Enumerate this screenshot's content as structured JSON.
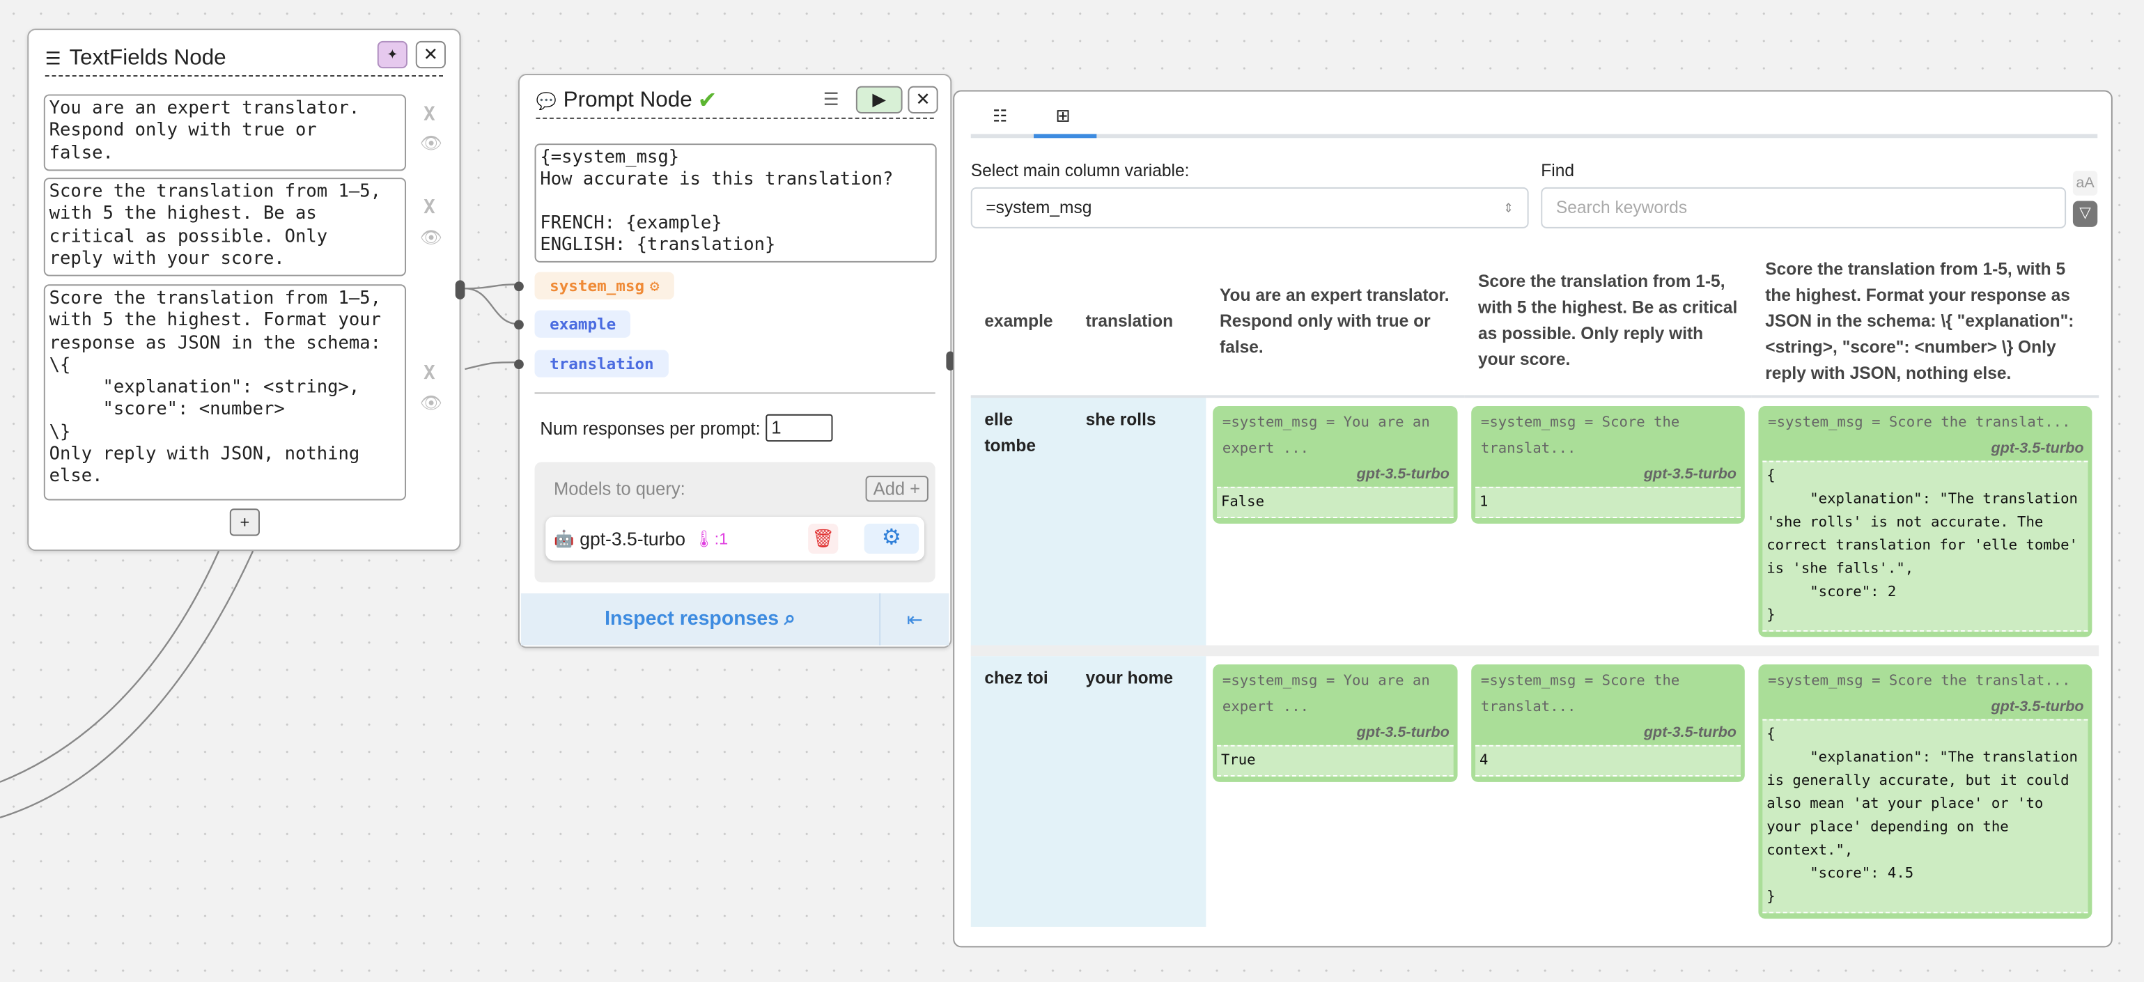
{
  "textfields_node": {
    "title": "TextFields Node",
    "fields": [
      "You are an expert translator.\nRespond only with true or\nfalse.",
      "Score the translation from 1–5,\nwith 5 the highest. Be as\ncritical as possible. Only\nreply with your score.",
      "Score the translation from 1–5,\nwith 5 the highest. Format your\nresponse as JSON in the schema:\n\\{\n     \"explanation\": <string>,\n     \"score\": <number>\n\\}\nOnly reply with JSON, nothing\nelse."
    ],
    "remove_label": "X",
    "add_label": "+"
  },
  "prompt_node": {
    "title": "Prompt Node",
    "status": "✔",
    "prompt": "{=system_msg}\nHow accurate is this translation?\n\nFRENCH: {example}\nENGLISH: {translation}",
    "vars": [
      "system_msg",
      "example",
      "translation"
    ],
    "num_label": "Num responses per prompt:",
    "num_value": "1",
    "models_label": "Models to query:",
    "add_model": "Add +",
    "model": {
      "name": "gpt-3.5-turbo",
      "temp": ":1"
    },
    "inspect": "Inspect responses"
  },
  "inspector": {
    "select_label": "Select main column variable:",
    "select_value": "=system_msg",
    "find_label": "Find",
    "find_placeholder": "Search keywords",
    "case_icon": "aA",
    "headers": [
      "example",
      "translation",
      "You are an expert translator. Respond only with true or false.",
      "Score the translation from 1-5, with 5 the highest. Be as critical as possible. Only reply with your score.",
      "Score the translation from 1-5, with 5 the highest. Format your response as JSON in the schema: \\{ \"explanation\": <string>, \"score\": <number> \\} Only reply with JSON, nothing else."
    ],
    "rows": [
      {
        "example": "elle tombe",
        "translation": "she rolls",
        "cells": [
          {
            "var": "=system_msg = You are an expert ...",
            "model": "gpt-3.5-turbo",
            "out": "False"
          },
          {
            "var": "=system_msg = Score the translat...",
            "model": "gpt-3.5-turbo",
            "out": "1"
          },
          {
            "var": "=system_msg = Score the translat...",
            "model": "gpt-3.5-turbo",
            "out": "{\n     \"explanation\": \"The translation 'she rolls' is not accurate. The correct translation for 'elle tombe' is 'she falls'.\",\n     \"score\": 2\n}"
          }
        ]
      },
      {
        "example": "chez toi",
        "translation": "your home",
        "cells": [
          {
            "var": "=system_msg = You are an expert ...",
            "model": "gpt-3.5-turbo",
            "out": "True"
          },
          {
            "var": "=system_msg = Score the translat...",
            "model": "gpt-3.5-turbo",
            "out": "4"
          },
          {
            "var": "=system_msg = Score the translat...",
            "model": "gpt-3.5-turbo",
            "out": "{\n     \"explanation\": \"The translation is generally accurate, but it could also mean 'at your place' or 'to your place' depending on the context.\",\n     \"score\": 4.5\n}"
          }
        ]
      }
    ]
  }
}
